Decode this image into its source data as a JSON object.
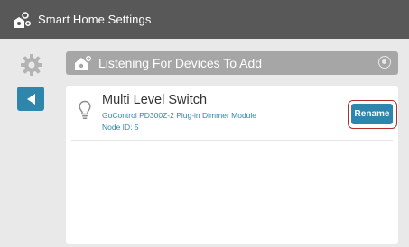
{
  "app": {
    "title": "Smart Home Settings",
    "title_icon": "smart-home-logo-icon"
  },
  "sidebar": {
    "settings_icon": "gear-icon",
    "back_icon": "back-arrow-icon"
  },
  "header": {
    "label": "Listening For Devices To Add",
    "icon": "add-device-icon",
    "status_icon": "listening-indicator-icon"
  },
  "device": {
    "name": "Multi Level Switch",
    "model": "GoControl PD300Z-2 Plug-in Dimmer Module",
    "node": "Node ID: 5",
    "icon": "light-bulb-icon",
    "rename_label": "Rename"
  },
  "colors": {
    "titlebar": "#585858",
    "accent": "#2e86ad",
    "header_bar": "#a6a6a6",
    "highlight": "#b0302d"
  }
}
